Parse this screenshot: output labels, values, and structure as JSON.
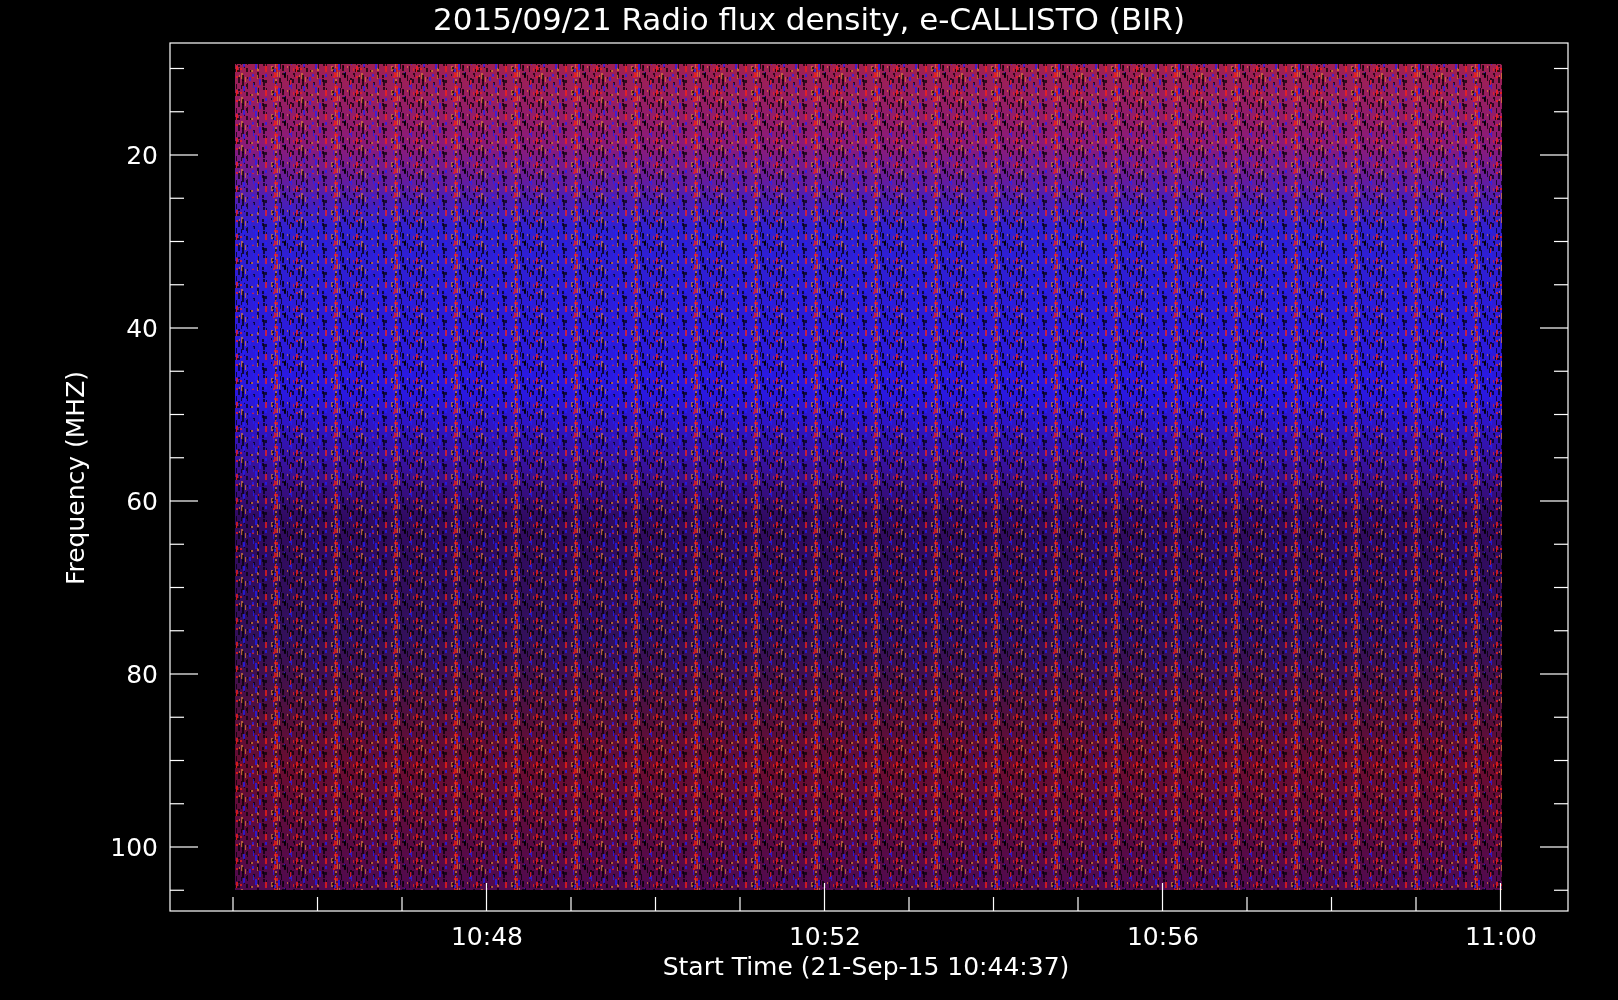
{
  "title": "2015/09/21  Radio flux density, e-CALLISTO (BIR)",
  "y_axis": {
    "label": "Frequency (MHZ)",
    "ticks": [
      "20",
      "40",
      "60",
      "80",
      "100"
    ]
  },
  "x_axis": {
    "label": "Start Time (21-Sep-15 10:44:37)",
    "ticks": [
      "10:48",
      "10:52",
      "10:56",
      "11:00"
    ]
  }
}
